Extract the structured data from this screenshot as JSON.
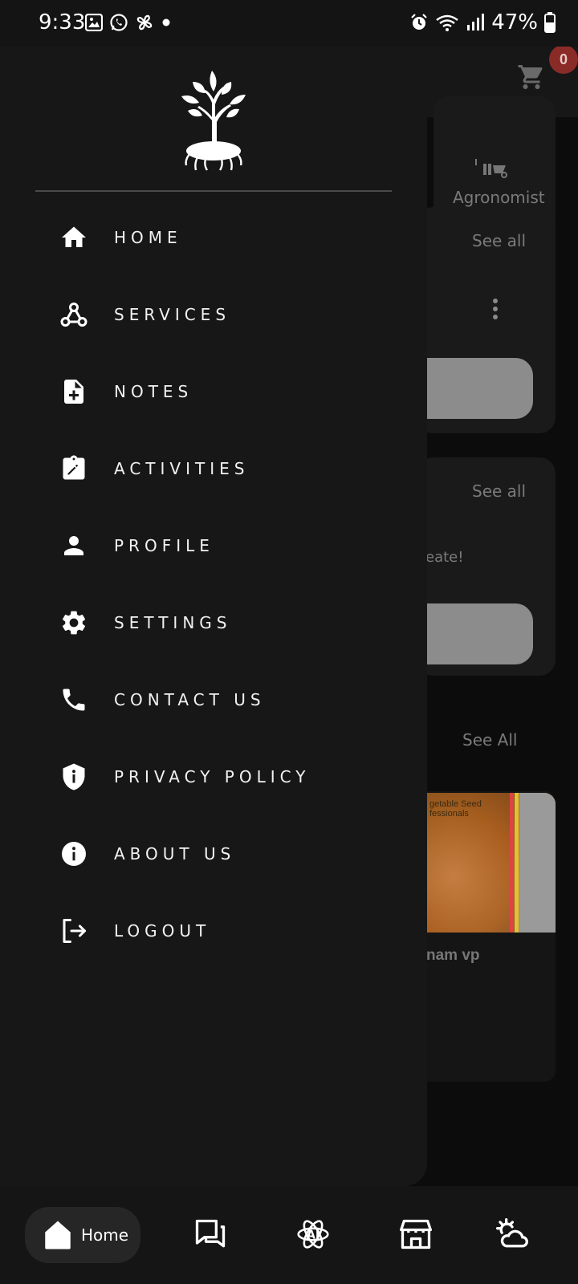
{
  "status_bar": {
    "time": "9:33",
    "battery": "47%"
  },
  "background": {
    "cart_count": "0",
    "agronomist_label": "Agronomist",
    "see_all_1": "See all",
    "see_all_2": "See all",
    "partial_text": "eate!",
    "see_all_3": "See All",
    "product_image_text_1": "getable Seed",
    "product_image_text_2": "fessionals",
    "product_name": "nam vp"
  },
  "drawer": {
    "menu": [
      {
        "label": "HOME",
        "icon": "home-icon"
      },
      {
        "label": "SERVICES",
        "icon": "webhook-icon"
      },
      {
        "label": "NOTES",
        "icon": "note-add-icon"
      },
      {
        "label": "ACTIVITIES",
        "icon": "assignment-edit-icon"
      },
      {
        "label": "PROFILE",
        "icon": "person-icon"
      },
      {
        "label": "SETTINGS",
        "icon": "gear-icon"
      },
      {
        "label": "CONTACT US",
        "icon": "phone-icon"
      },
      {
        "label": "PRIVACY POLICY",
        "icon": "shield-info-icon"
      },
      {
        "label": "ABOUT US",
        "icon": "info-icon"
      },
      {
        "label": "LOGOUT",
        "icon": "logout-icon"
      }
    ]
  },
  "bottom_nav": {
    "home_label": "Home",
    "items": [
      "home-icon",
      "chat-icon",
      "ai-icon",
      "store-icon",
      "weather-icon"
    ]
  },
  "colors": {
    "drawer_bg": "#171717",
    "badge": "#8a2b28",
    "text": "#f2f2f2"
  }
}
